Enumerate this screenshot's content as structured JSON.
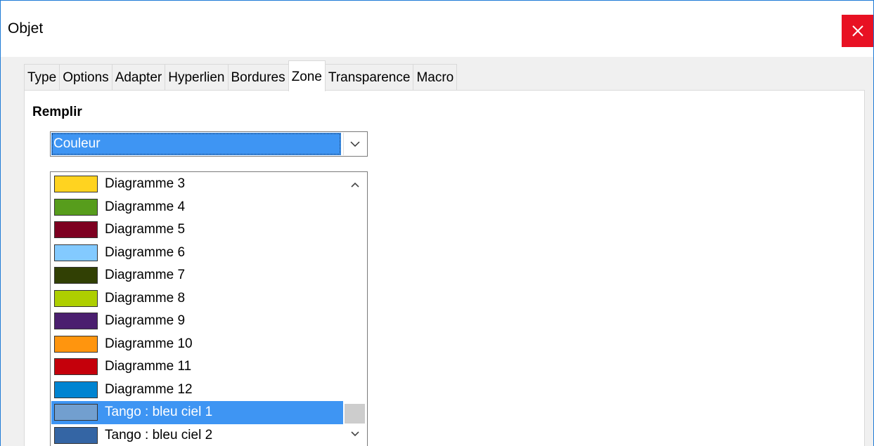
{
  "window": {
    "title": "Objet",
    "close_icon": "close-icon"
  },
  "tabs": [
    {
      "label": "Type",
      "active": false
    },
    {
      "label": "Options",
      "active": false
    },
    {
      "label": "Adapter",
      "active": false
    },
    {
      "label": "Hyperlien",
      "active": false
    },
    {
      "label": "Bordures",
      "active": false
    },
    {
      "label": "Zone",
      "active": true
    },
    {
      "label": "Transparence",
      "active": false
    },
    {
      "label": "Macro",
      "active": false
    }
  ],
  "fill": {
    "section_label": "Remplir",
    "selected_value": "Couleur",
    "dropdown_icon": "chevron-down-icon"
  },
  "colors": [
    {
      "label": "Diagramme 3",
      "color": "#ffd320",
      "selected": false
    },
    {
      "label": "Diagramme 4",
      "color": "#579d1c",
      "selected": false
    },
    {
      "label": "Diagramme 5",
      "color": "#7e0021",
      "selected": false
    },
    {
      "label": "Diagramme 6",
      "color": "#83caff",
      "selected": false
    },
    {
      "label": "Diagramme 7",
      "color": "#314004",
      "selected": false
    },
    {
      "label": "Diagramme 8",
      "color": "#aecf00",
      "selected": false
    },
    {
      "label": "Diagramme 9",
      "color": "#4b1f6f",
      "selected": false
    },
    {
      "label": "Diagramme 10",
      "color": "#ff950e",
      "selected": false
    },
    {
      "label": "Diagramme 11",
      "color": "#c5000b",
      "selected": false
    },
    {
      "label": "Diagramme 12",
      "color": "#0084d1",
      "selected": false
    },
    {
      "label": "Tango : bleu ciel 1",
      "color": "#729fcf",
      "selected": true
    },
    {
      "label": "Tango : bleu ciel 2",
      "color": "#3465a4",
      "selected": false
    }
  ],
  "scrollbar": {
    "up_icon": "chevron-up-icon",
    "down_icon": "chevron-down-icon"
  }
}
